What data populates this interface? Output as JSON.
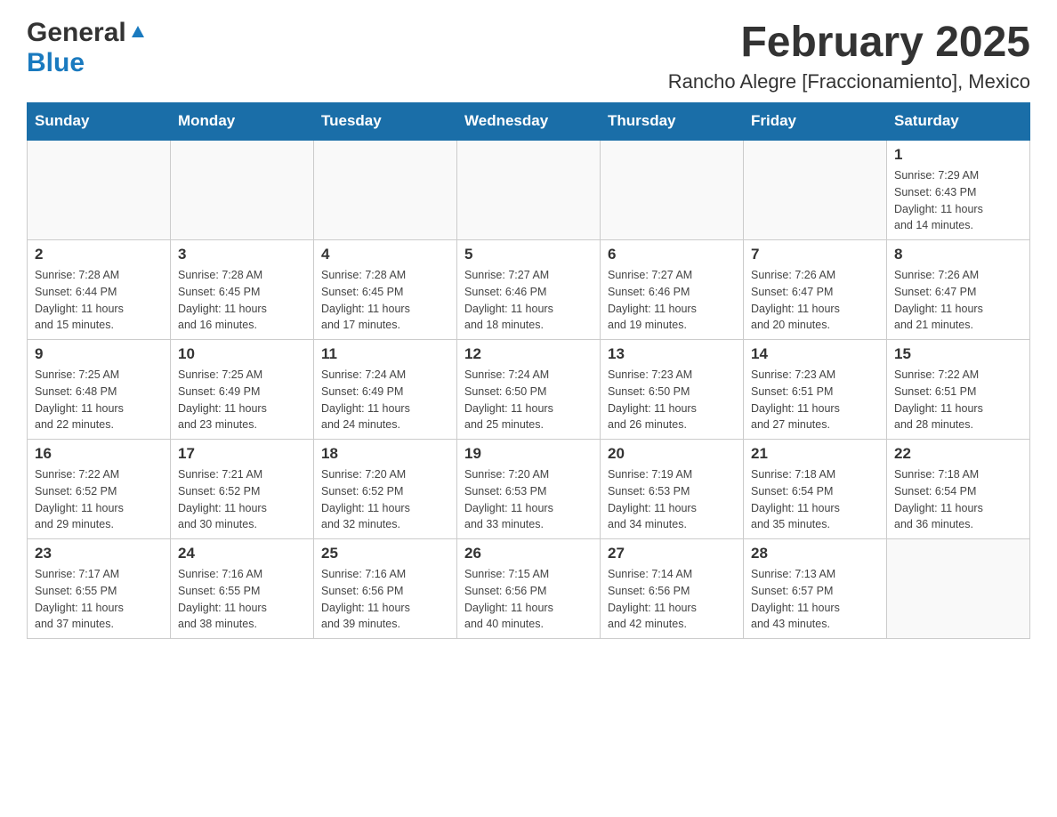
{
  "logo": {
    "general": "General",
    "blue": "Blue"
  },
  "header": {
    "month_year": "February 2025",
    "location": "Rancho Alegre [Fraccionamiento], Mexico"
  },
  "days_of_week": [
    "Sunday",
    "Monday",
    "Tuesday",
    "Wednesday",
    "Thursday",
    "Friday",
    "Saturday"
  ],
  "weeks": [
    [
      {
        "day": "",
        "info": ""
      },
      {
        "day": "",
        "info": ""
      },
      {
        "day": "",
        "info": ""
      },
      {
        "day": "",
        "info": ""
      },
      {
        "day": "",
        "info": ""
      },
      {
        "day": "",
        "info": ""
      },
      {
        "day": "1",
        "info": "Sunrise: 7:29 AM\nSunset: 6:43 PM\nDaylight: 11 hours\nand 14 minutes."
      }
    ],
    [
      {
        "day": "2",
        "info": "Sunrise: 7:28 AM\nSunset: 6:44 PM\nDaylight: 11 hours\nand 15 minutes."
      },
      {
        "day": "3",
        "info": "Sunrise: 7:28 AM\nSunset: 6:45 PM\nDaylight: 11 hours\nand 16 minutes."
      },
      {
        "day": "4",
        "info": "Sunrise: 7:28 AM\nSunset: 6:45 PM\nDaylight: 11 hours\nand 17 minutes."
      },
      {
        "day": "5",
        "info": "Sunrise: 7:27 AM\nSunset: 6:46 PM\nDaylight: 11 hours\nand 18 minutes."
      },
      {
        "day": "6",
        "info": "Sunrise: 7:27 AM\nSunset: 6:46 PM\nDaylight: 11 hours\nand 19 minutes."
      },
      {
        "day": "7",
        "info": "Sunrise: 7:26 AM\nSunset: 6:47 PM\nDaylight: 11 hours\nand 20 minutes."
      },
      {
        "day": "8",
        "info": "Sunrise: 7:26 AM\nSunset: 6:47 PM\nDaylight: 11 hours\nand 21 minutes."
      }
    ],
    [
      {
        "day": "9",
        "info": "Sunrise: 7:25 AM\nSunset: 6:48 PM\nDaylight: 11 hours\nand 22 minutes."
      },
      {
        "day": "10",
        "info": "Sunrise: 7:25 AM\nSunset: 6:49 PM\nDaylight: 11 hours\nand 23 minutes."
      },
      {
        "day": "11",
        "info": "Sunrise: 7:24 AM\nSunset: 6:49 PM\nDaylight: 11 hours\nand 24 minutes."
      },
      {
        "day": "12",
        "info": "Sunrise: 7:24 AM\nSunset: 6:50 PM\nDaylight: 11 hours\nand 25 minutes."
      },
      {
        "day": "13",
        "info": "Sunrise: 7:23 AM\nSunset: 6:50 PM\nDaylight: 11 hours\nand 26 minutes."
      },
      {
        "day": "14",
        "info": "Sunrise: 7:23 AM\nSunset: 6:51 PM\nDaylight: 11 hours\nand 27 minutes."
      },
      {
        "day": "15",
        "info": "Sunrise: 7:22 AM\nSunset: 6:51 PM\nDaylight: 11 hours\nand 28 minutes."
      }
    ],
    [
      {
        "day": "16",
        "info": "Sunrise: 7:22 AM\nSunset: 6:52 PM\nDaylight: 11 hours\nand 29 minutes."
      },
      {
        "day": "17",
        "info": "Sunrise: 7:21 AM\nSunset: 6:52 PM\nDaylight: 11 hours\nand 30 minutes."
      },
      {
        "day": "18",
        "info": "Sunrise: 7:20 AM\nSunset: 6:52 PM\nDaylight: 11 hours\nand 32 minutes."
      },
      {
        "day": "19",
        "info": "Sunrise: 7:20 AM\nSunset: 6:53 PM\nDaylight: 11 hours\nand 33 minutes."
      },
      {
        "day": "20",
        "info": "Sunrise: 7:19 AM\nSunset: 6:53 PM\nDaylight: 11 hours\nand 34 minutes."
      },
      {
        "day": "21",
        "info": "Sunrise: 7:18 AM\nSunset: 6:54 PM\nDaylight: 11 hours\nand 35 minutes."
      },
      {
        "day": "22",
        "info": "Sunrise: 7:18 AM\nSunset: 6:54 PM\nDaylight: 11 hours\nand 36 minutes."
      }
    ],
    [
      {
        "day": "23",
        "info": "Sunrise: 7:17 AM\nSunset: 6:55 PM\nDaylight: 11 hours\nand 37 minutes."
      },
      {
        "day": "24",
        "info": "Sunrise: 7:16 AM\nSunset: 6:55 PM\nDaylight: 11 hours\nand 38 minutes."
      },
      {
        "day": "25",
        "info": "Sunrise: 7:16 AM\nSunset: 6:56 PM\nDaylight: 11 hours\nand 39 minutes."
      },
      {
        "day": "26",
        "info": "Sunrise: 7:15 AM\nSunset: 6:56 PM\nDaylight: 11 hours\nand 40 minutes."
      },
      {
        "day": "27",
        "info": "Sunrise: 7:14 AM\nSunset: 6:56 PM\nDaylight: 11 hours\nand 42 minutes."
      },
      {
        "day": "28",
        "info": "Sunrise: 7:13 AM\nSunset: 6:57 PM\nDaylight: 11 hours\nand 43 minutes."
      },
      {
        "day": "",
        "info": ""
      }
    ]
  ]
}
